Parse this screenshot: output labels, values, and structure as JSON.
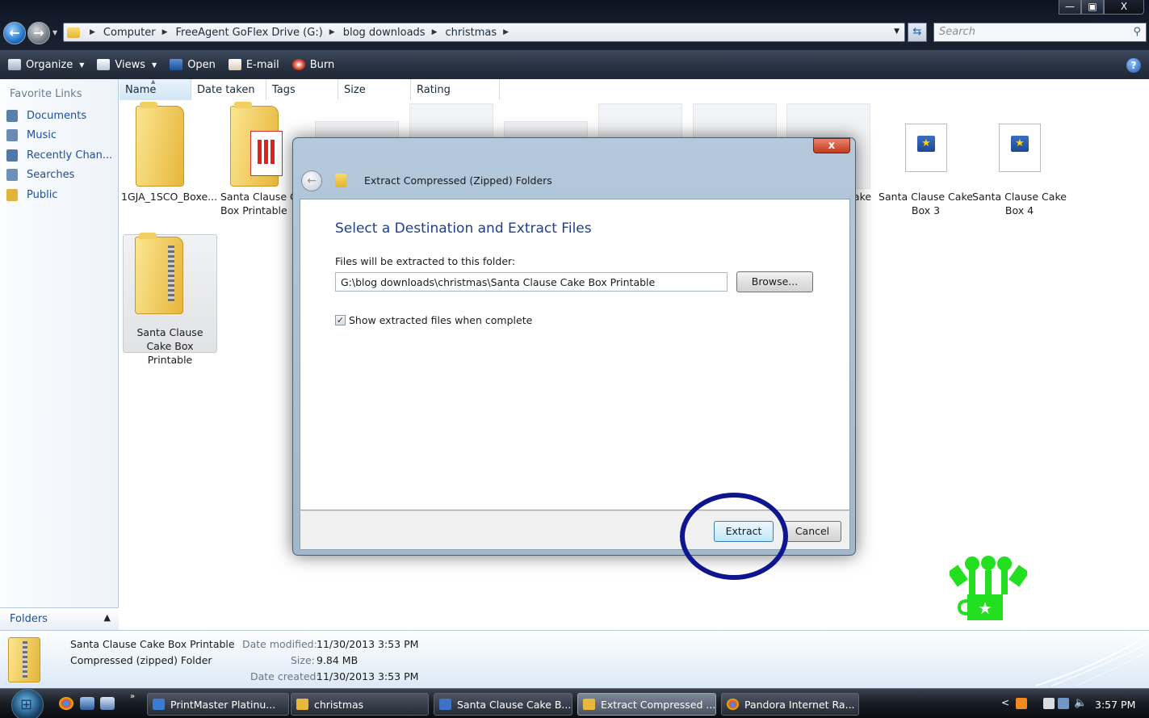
{
  "window": {
    "controls": {
      "minimize": "—",
      "maximize": "▣",
      "close": "X"
    }
  },
  "address": {
    "breadcrumbs": [
      "Computer",
      "FreeAgent GoFlex Drive (G:)",
      "blog downloads",
      "christmas"
    ]
  },
  "search": {
    "placeholder": "Search"
  },
  "toolbar": {
    "organize": "Organize",
    "views": "Views",
    "open": "Open",
    "email": "E-mail",
    "burn": "Burn",
    "help": "?"
  },
  "sidebar": {
    "title": "Favorite Links",
    "items": [
      {
        "label": "Documents",
        "icon": "documents-icon",
        "color": "#5b7faa"
      },
      {
        "label": "Music",
        "icon": "music-icon",
        "color": "#6b8bb3"
      },
      {
        "label": "Recently Chan...",
        "icon": "recent-icon",
        "color": "#4f79a8"
      },
      {
        "label": "Searches",
        "icon": "search-folder-icon",
        "color": "#6d8fb8"
      },
      {
        "label": "Public",
        "icon": "folder-icon",
        "color": "#e2b33c"
      }
    ],
    "folders_label": "Folders"
  },
  "columns": [
    "Name",
    "Date taken",
    "Tags",
    "Size",
    "Rating"
  ],
  "files": [
    {
      "name": "1GJA_1SCO_Boxe...",
      "type": "folder"
    },
    {
      "name": "Santa Clause C... Box Printable",
      "type": "folder"
    },
    {
      "name": "Santa Clause Cake Box 3",
      "type": "image"
    },
    {
      "name": "Santa Clause Cake Box 4",
      "type": "image"
    },
    {
      "name": "Santa Clause Cake Box Printable",
      "type": "zip",
      "selected": true
    },
    {
      "name": "ake",
      "type": "image"
    }
  ],
  "dialog": {
    "title": "Extract Compressed (Zipped) Folders",
    "heading": "Select a Destination and Extract Files",
    "dest_label": "Files will be extracted to this folder:",
    "dest_value": "G:\\blog downloads\\christmas\\Santa Clause Cake Box Printable",
    "browse": "Browse...",
    "show_files_label": "Show extracted files when complete",
    "show_files_checked": true,
    "extract": "Extract",
    "cancel": "Cancel",
    "close": "x"
  },
  "details": {
    "name": "Santa Clause Cake Box Printable",
    "type": "Compressed (zipped) Folder",
    "modified_label": "Date modified:",
    "modified_value": "11/30/2013 3:53 PM",
    "size_label": "Size:",
    "size_value": "9.84 MB",
    "created_label": "Date created:",
    "created_value": "11/30/2013 3:53 PM"
  },
  "taskbar": {
    "tasks": [
      {
        "label": "PrintMaster Platinu...",
        "icon": "printmaster-icon",
        "color": "#3a7bd5"
      },
      {
        "label": "christmas",
        "icon": "folder-icon",
        "color": "#e8b73c"
      },
      {
        "label": "Santa Clause Cake B...",
        "icon": "image-icon",
        "color": "#3d72c4"
      },
      {
        "label": "Extract Compressed ...",
        "icon": "zip-folder-icon",
        "color": "#e8b73c",
        "active": true
      },
      {
        "label": "Pandora Internet Ra...",
        "icon": "chrome-icon",
        "color": "#db4437"
      }
    ],
    "more": "»",
    "clock": "3:57 PM"
  },
  "colors": {
    "highlight_circle": "#0d168f",
    "logo_green": "#22e01f"
  }
}
